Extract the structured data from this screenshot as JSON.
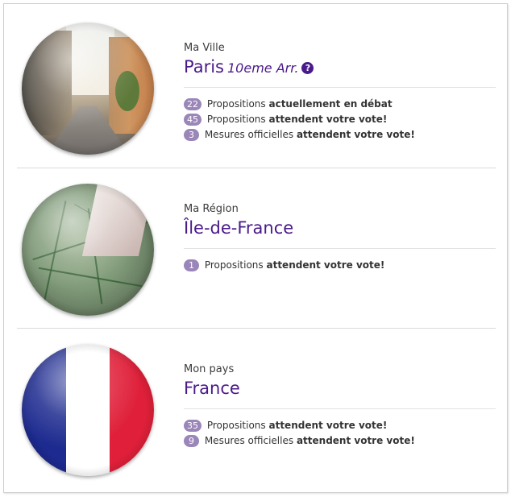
{
  "sections": [
    {
      "kicker": "Ma Ville",
      "place": "Paris",
      "sub": "10eme Arr.",
      "help": "?",
      "image": "paris-street-photo",
      "stats": [
        {
          "count": "22",
          "text": "Propositions",
          "bold": "actuellement en débat"
        },
        {
          "count": "45",
          "text": "Propositions",
          "bold": "attendent votre vote!"
        },
        {
          "count": "3",
          "text": "Mesures officielles",
          "bold": "attendent votre vote!"
        }
      ]
    },
    {
      "kicker": "Ma Région",
      "place": "Île-de-France",
      "image": "map-photo",
      "stats": [
        {
          "count": "1",
          "text": "Propositions",
          "bold": "attendent votre vote!"
        }
      ]
    },
    {
      "kicker": "Mon pays",
      "place": "France",
      "image": "french-flag",
      "stats": [
        {
          "count": "35",
          "text": "Propositions",
          "bold": "attendent votre vote!"
        },
        {
          "count": "9",
          "text": "Mesures officielles",
          "bold": "attendent votre vote!"
        }
      ]
    }
  ],
  "colors": {
    "accent": "#4a1a8a",
    "badge": "#9a86b8"
  }
}
